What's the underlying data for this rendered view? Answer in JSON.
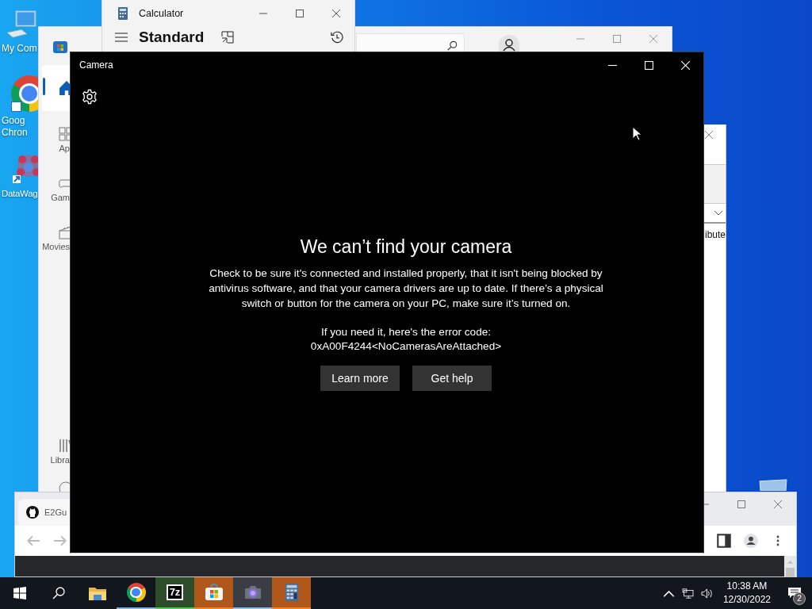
{
  "desktop": {
    "icons": [
      {
        "kind": "computer",
        "label": [
          "My Com"
        ]
      },
      {
        "kind": "chrome",
        "label": [
          "Goog",
          "Chron"
        ]
      },
      {
        "kind": "datawag",
        "label": [
          "DataWag"
        ]
      },
      {
        "kind": "recycle"
      }
    ]
  },
  "store_window": {
    "nav": [
      {
        "kind": "home",
        "selected": true
      },
      {
        "kind": "apps",
        "label": "Ap",
        "selected": false
      },
      {
        "kind": "games",
        "label": "Gam",
        "selected": false
      },
      {
        "kind": "movies",
        "label": "Movies",
        "selected": false
      },
      {
        "kind": "library",
        "label": "Libra",
        "selected": false
      },
      {
        "kind": "help",
        "selected": false
      }
    ]
  },
  "calculator_window": {
    "title": "Calculator",
    "mode": "Standard"
  },
  "side_window": {
    "text": "ibute"
  },
  "browser_window": {
    "tab": "E2Gu"
  },
  "camera_window": {
    "title": "Camera",
    "heading": "We can’t find your camera",
    "message": "Check to be sure it's connected and installed properly, that it isn't being blocked by antivirus software, and that your camera drivers are up to date. If there’s a physical switch or button for the camera on your PC, make sure it’s turned on.",
    "error_intro": "If you need it, here's the error code:",
    "error_code": "0xA00F4244<NoCamerasAreAttached>",
    "buttons": [
      "Learn more",
      "Get help"
    ]
  },
  "taskbar": {
    "items": [
      {
        "kind": "start",
        "open": false,
        "selected": false,
        "flashing": false
      },
      {
        "kind": "search",
        "open": false,
        "selected": false,
        "flashing": false
      },
      {
        "kind": "folder",
        "open": false,
        "selected": false,
        "flashing": false
      },
      {
        "kind": "chrome",
        "open": true,
        "selected": false,
        "flashing": false
      },
      {
        "kind": "archiver",
        "label": "7z",
        "open": true,
        "selected": false,
        "flashing": false,
        "level": 1
      },
      {
        "kind": "store",
        "open": true,
        "selected": false,
        "flashing": true
      },
      {
        "kind": "camera",
        "open": true,
        "selected": true,
        "flashing": false
      },
      {
        "kind": "calculator",
        "open": true,
        "selected": false,
        "flashing": true
      }
    ],
    "clock": {
      "time": "10:38 AM",
      "date": "12/30/2022"
    },
    "notifications": "2"
  }
}
